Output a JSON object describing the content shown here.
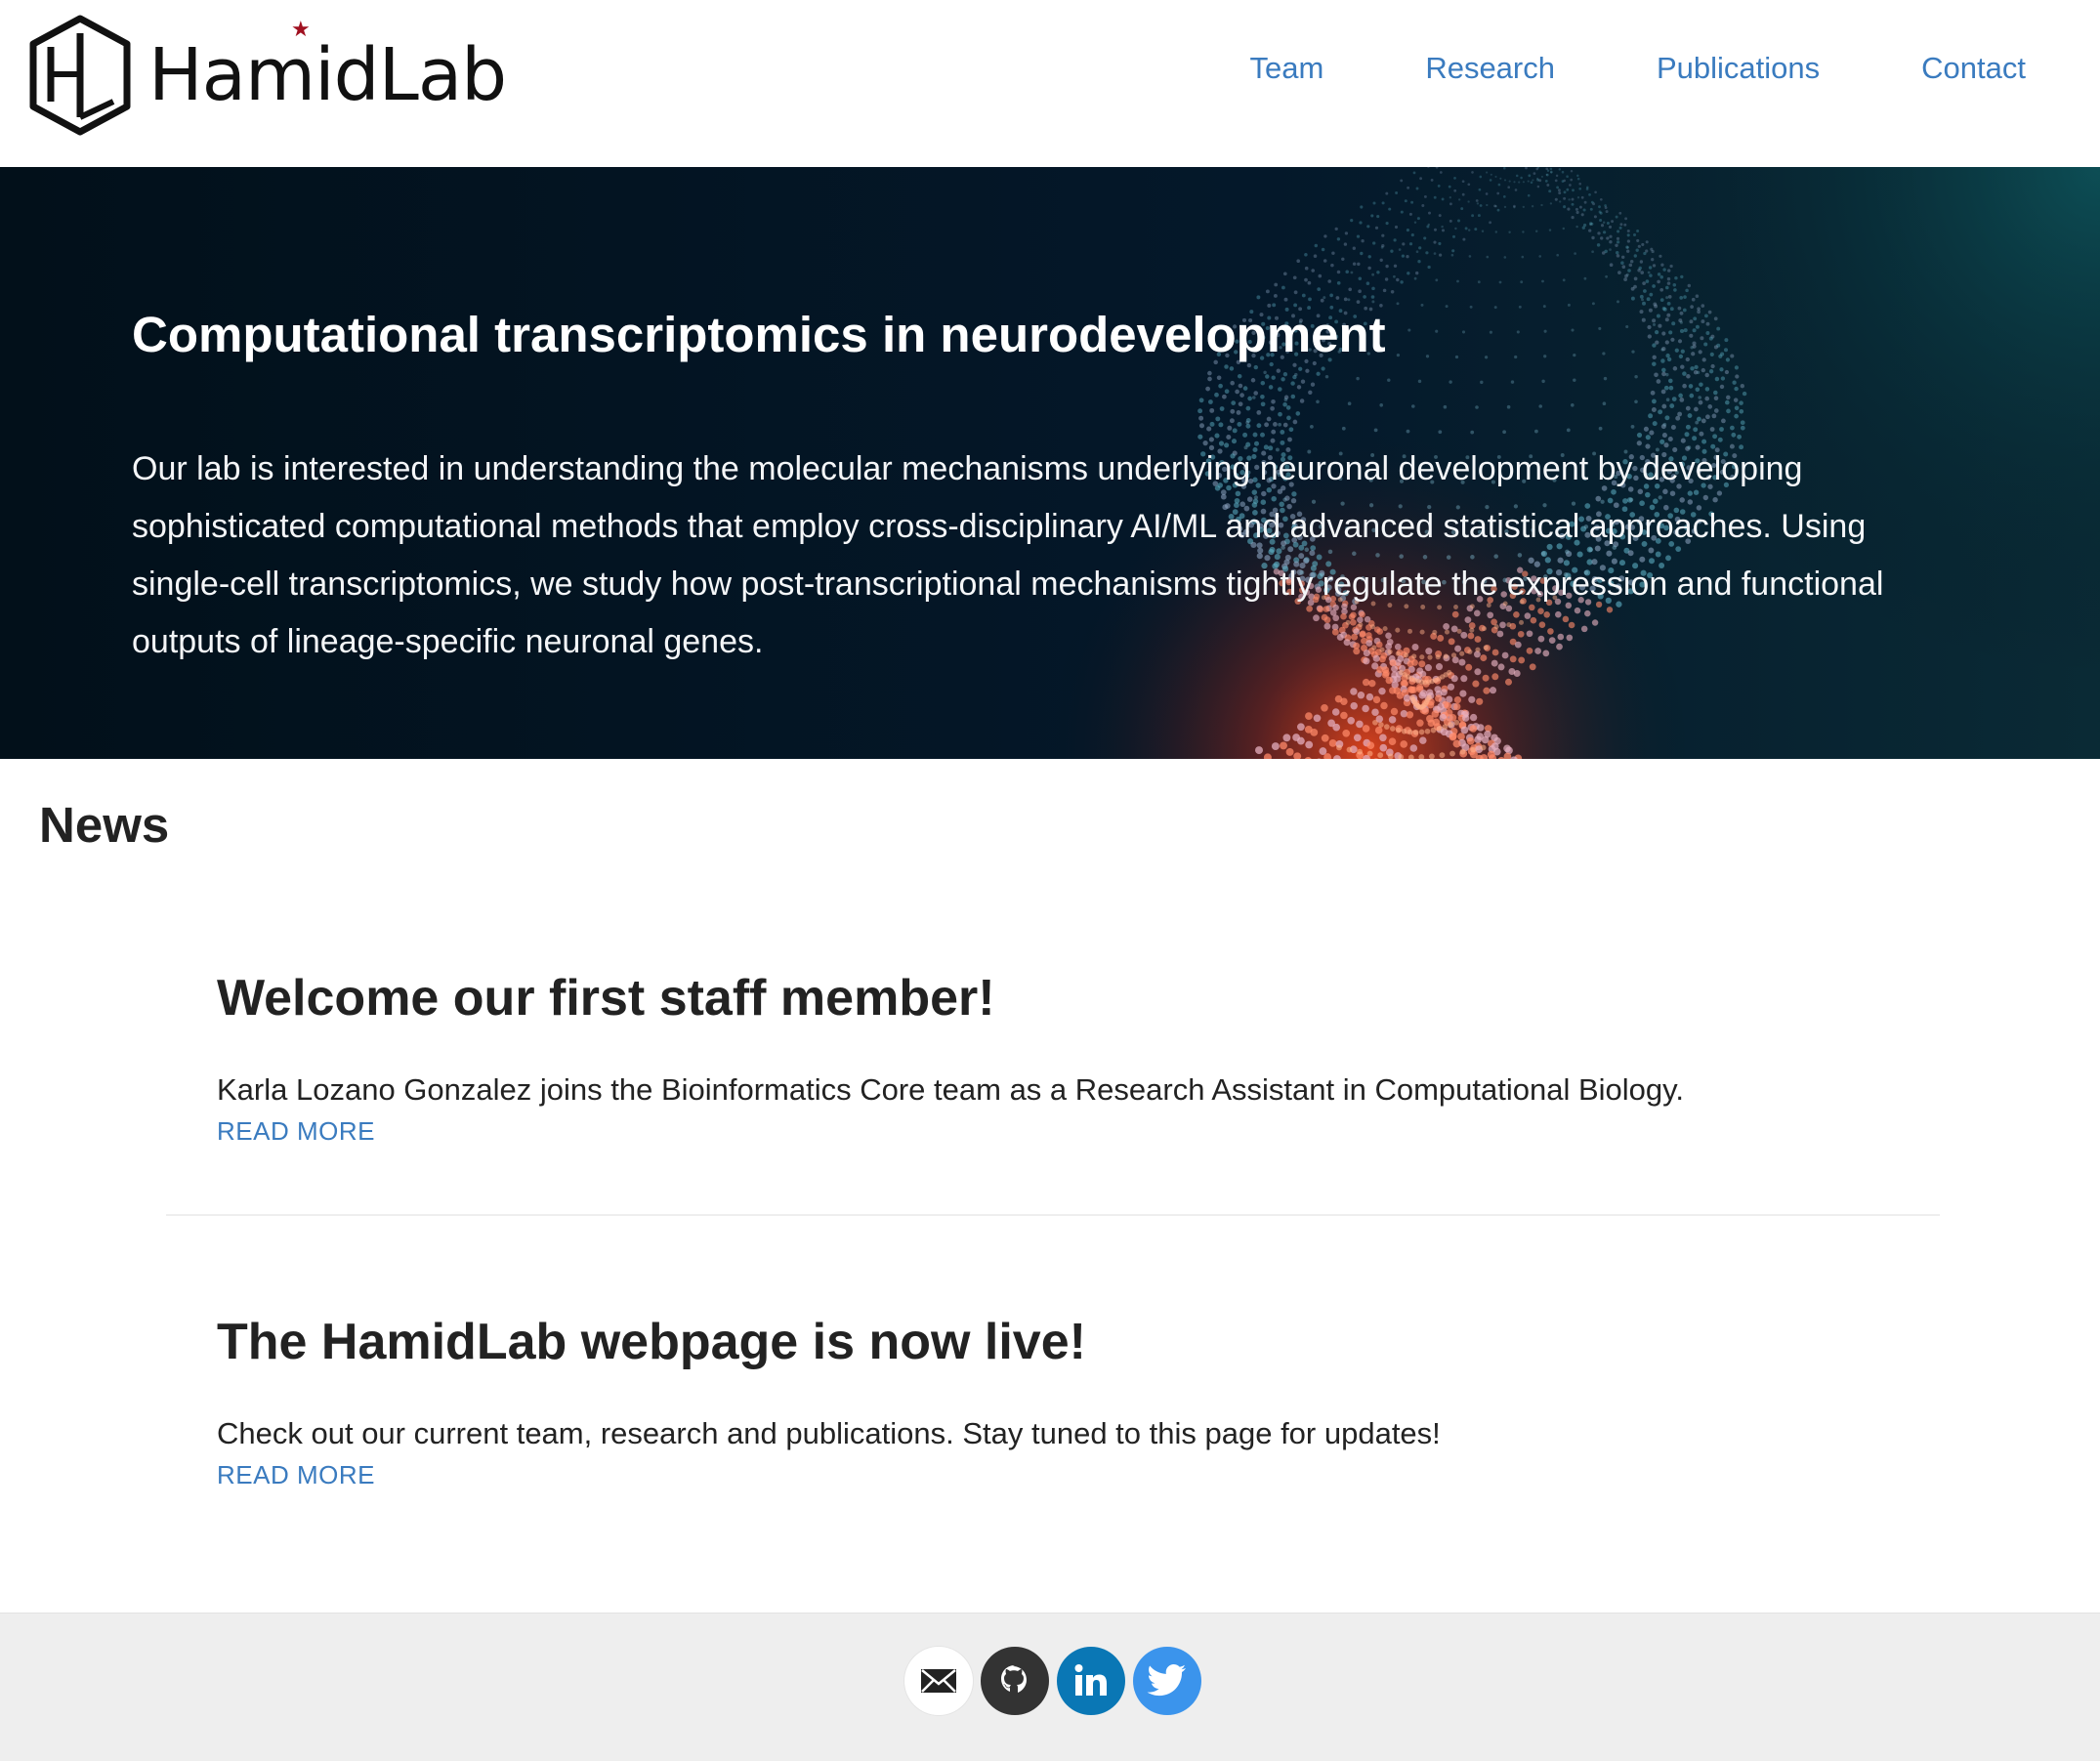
{
  "brand": {
    "name": "HamidLab",
    "logo_monogram": "HL"
  },
  "nav": {
    "items": [
      {
        "label": "Team"
      },
      {
        "label": "Research"
      },
      {
        "label": "Publications"
      },
      {
        "label": "Contact"
      }
    ]
  },
  "hero": {
    "title": "Computational transcriptomics in neurodevelopment",
    "text": "Our lab is interested in understanding the molecular mechanisms underlying neuronal development by developing sophisticated computational methods that employ cross-disciplinary AI/ML and advanced statistical approaches. Using single-cell transcriptomics, we study how post-transcriptional mechanisms tightly regulate the expression and functional outputs of lineage-specific neuronal genes."
  },
  "news": {
    "heading": "News",
    "items": [
      {
        "title": "Welcome our first staff member!",
        "summary": "Karla Lozano Gonzalez joins the Bioinformatics Core team as a Research Assistant in Computational Biology.",
        "link_label": "READ MORE"
      },
      {
        "title": "The HamidLab webpage is now live!",
        "summary": "Check out our current team, research and publications. Stay tuned to this page for updates!",
        "link_label": "READ MORE"
      }
    ]
  },
  "footer": {
    "social": [
      {
        "icon": "envelope-icon",
        "color": "#ffffff"
      },
      {
        "icon": "github-icon",
        "color": "#333333"
      },
      {
        "icon": "linkedin-icon",
        "color": "#0a77b5"
      },
      {
        "icon": "twitter-icon",
        "color": "#3b94ec"
      }
    ]
  },
  "colors": {
    "link": "#3a7bbf",
    "hero_bg": "#031520",
    "footer_bg": "#eeeeee",
    "logo_star": "#a01020"
  }
}
